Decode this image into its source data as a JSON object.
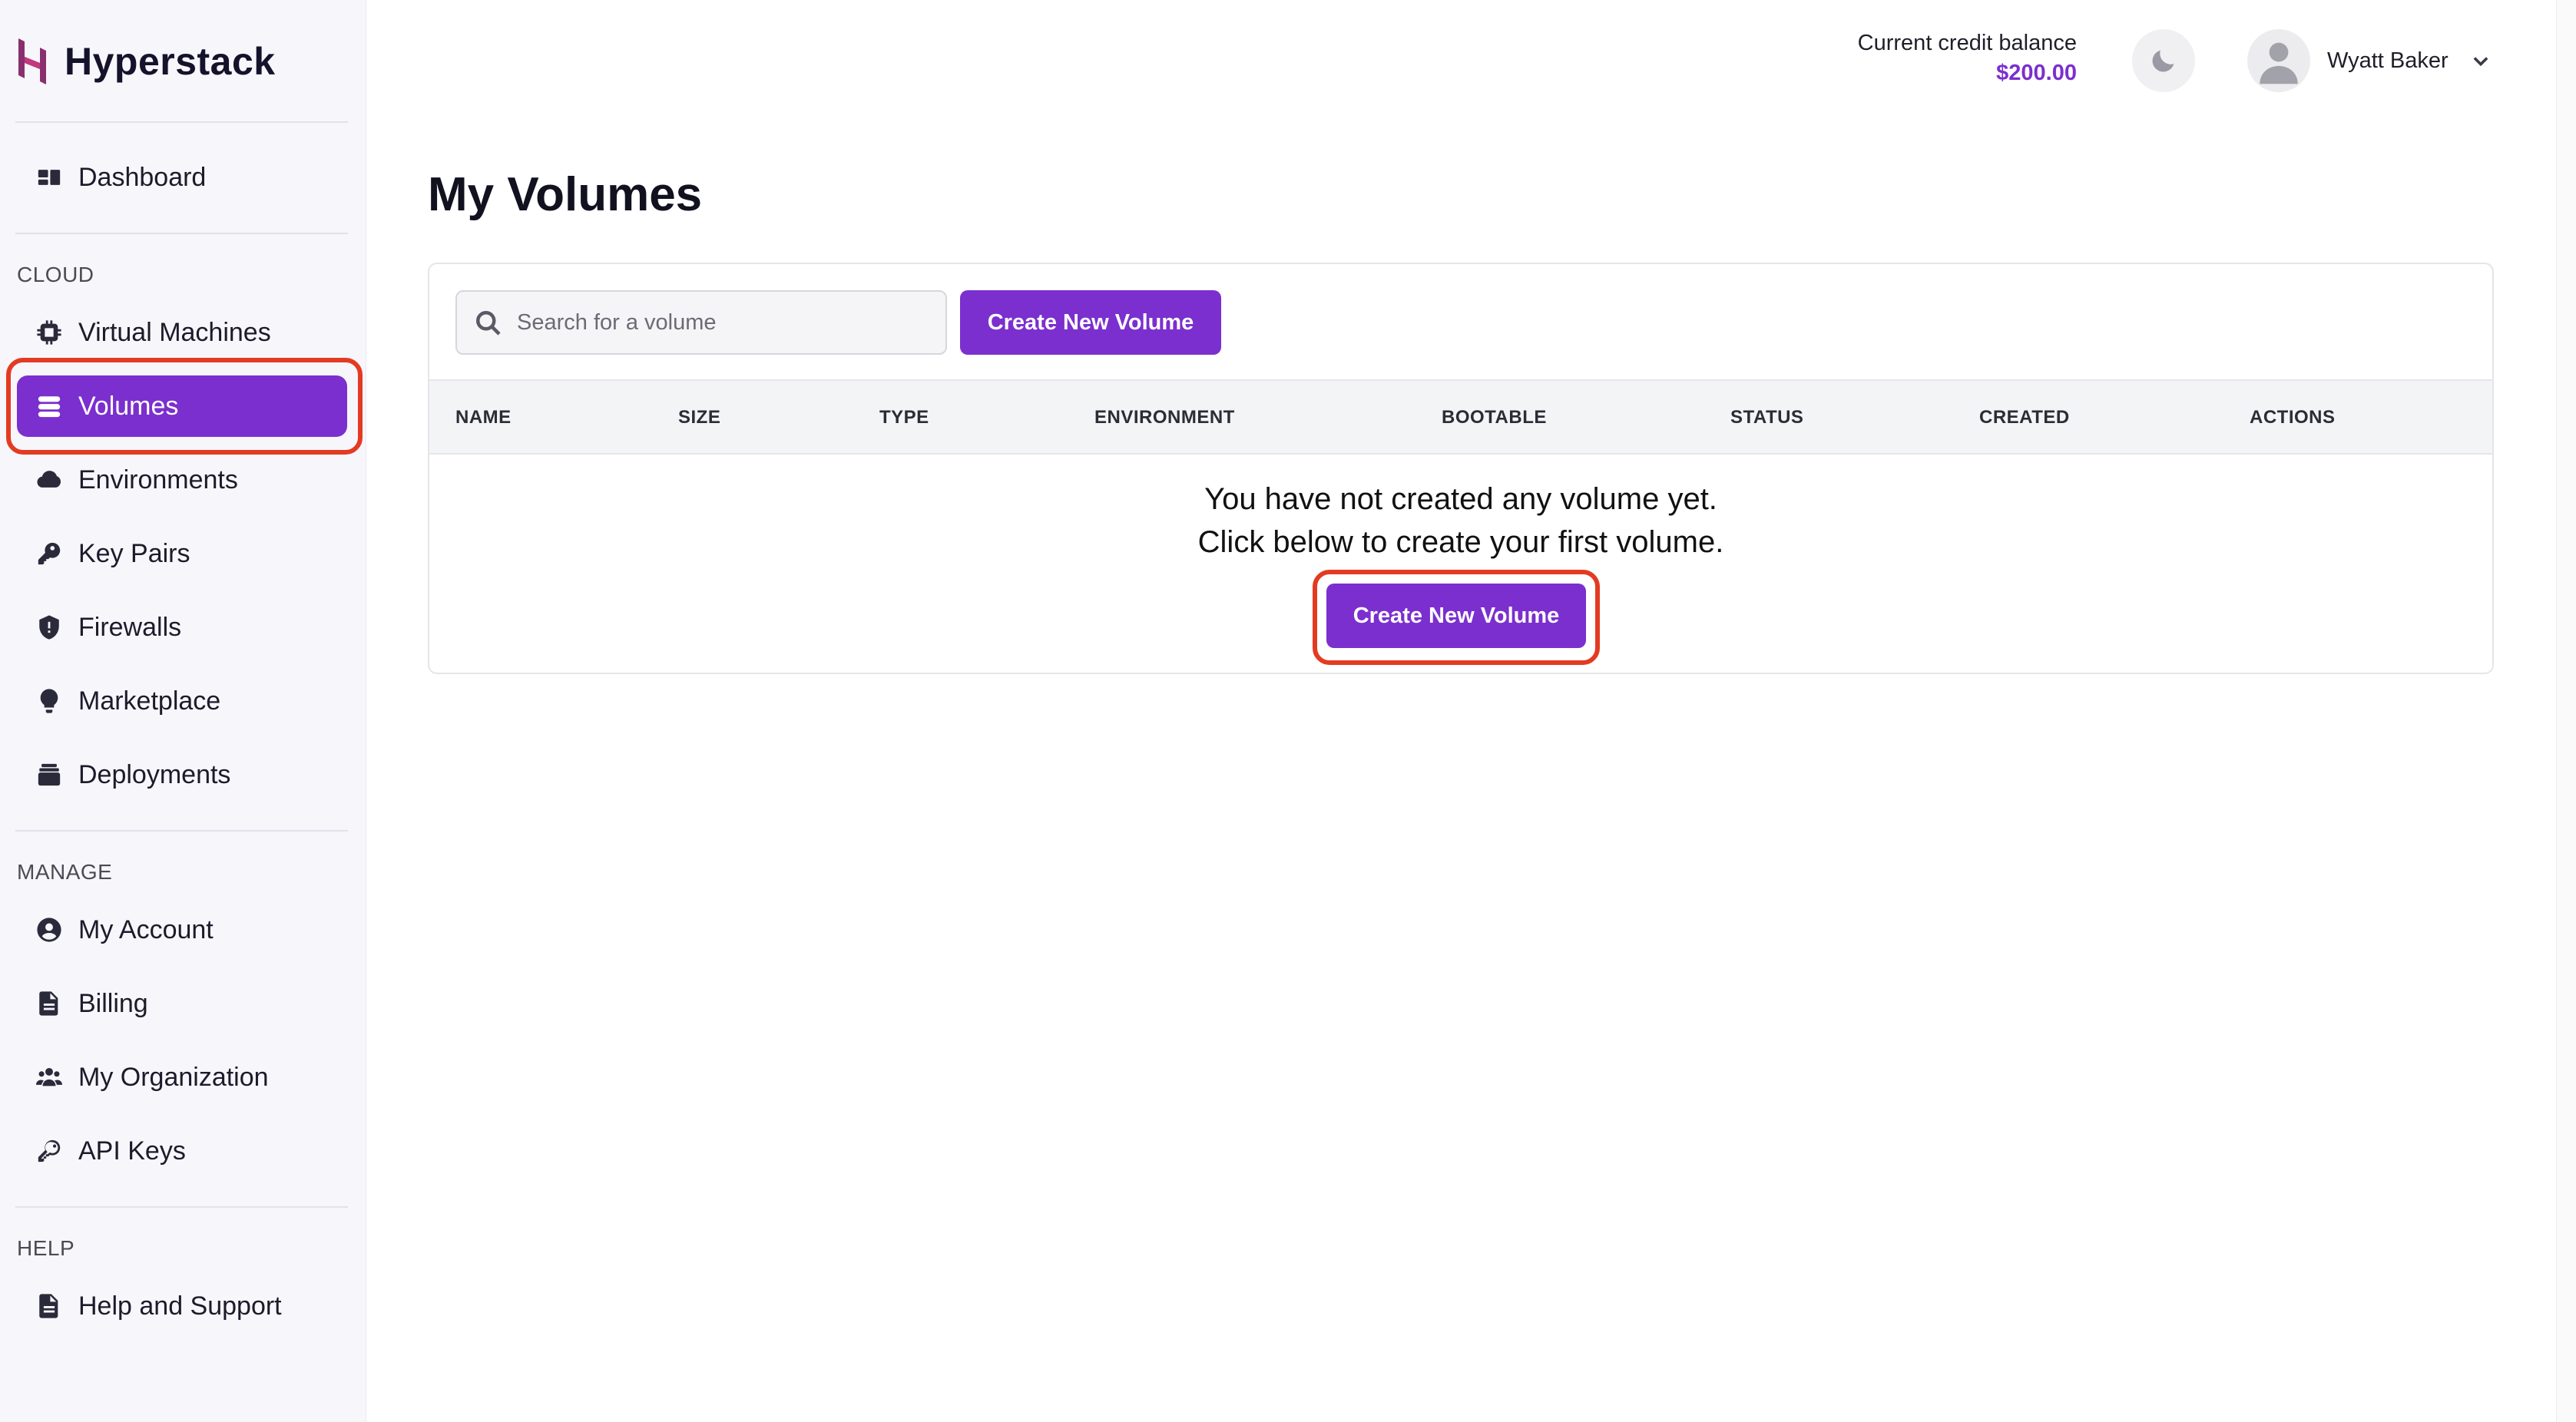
{
  "brand": {
    "name": "Hyperstack",
    "accent": "#7b2fce",
    "highlight": "#e33b22"
  },
  "sidebar": {
    "dashboard": {
      "label": "Dashboard",
      "icon": "dashboard-icon"
    },
    "sections": {
      "cloud": "CLOUD",
      "manage": "MANAGE",
      "help": "HELP"
    },
    "cloud_items": [
      {
        "label": "Virtual Machines",
        "icon": "chip-icon"
      },
      {
        "label": "Volumes",
        "icon": "database-icon",
        "active": true
      },
      {
        "label": "Environments",
        "icon": "cloud-icon"
      },
      {
        "label": "Key Pairs",
        "icon": "key-icon"
      },
      {
        "label": "Firewalls",
        "icon": "shield-icon"
      },
      {
        "label": "Marketplace",
        "icon": "lightbulb-icon"
      },
      {
        "label": "Deployments",
        "icon": "stack-icon"
      }
    ],
    "manage_items": [
      {
        "label": "My Account",
        "icon": "user-circle-icon"
      },
      {
        "label": "Billing",
        "icon": "document-icon"
      },
      {
        "label": "My Organization",
        "icon": "users-icon"
      },
      {
        "label": "API Keys",
        "icon": "key-outline-icon"
      }
    ],
    "help_items": [
      {
        "label": "Help and Support",
        "icon": "document-icon"
      }
    ]
  },
  "header": {
    "credit_label": "Current credit balance",
    "credit_value": "$200.00",
    "user_name": "Wyatt Baker"
  },
  "main": {
    "title": "My Volumes",
    "search_placeholder": "Search for a volume",
    "create_button": "Create New Volume",
    "columns": [
      "NAME",
      "SIZE",
      "TYPE",
      "ENVIRONMENT",
      "BOOTABLE",
      "STATUS",
      "CREATED",
      "ACTIONS"
    ],
    "empty_line1": "You have not created any volume yet.",
    "empty_line2": "Click below to create your first volume.",
    "empty_button": "Create New Volume"
  }
}
